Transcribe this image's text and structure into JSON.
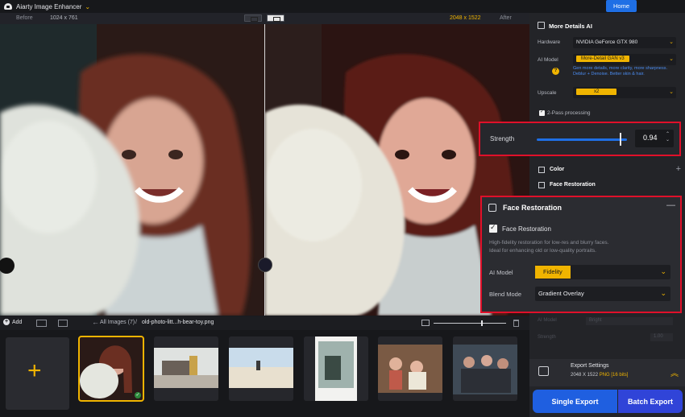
{
  "app": {
    "title": "Aiarty Image Enhancer",
    "home_label": "Home"
  },
  "view": {
    "before_label": "Before",
    "before_dims": "1024 x 761",
    "after_dims": "2048 x 1522",
    "after_label": "After"
  },
  "filmstrip": {
    "add_label": "Add",
    "breadcrumb_all": "All Images (7)",
    "breadcrumb_sep": "/",
    "breadcrumb_file": "old-photo-litt...h-bear-toy.png",
    "add_tile_plus": "+",
    "selected_check": "✓"
  },
  "panel": {
    "section_title": "More Details AI",
    "hardware_label": "Hardware",
    "hardware_value": "NVIDIA GeForce GTX 980",
    "ai_model_label": "AI Model",
    "ai_model_value": "More-Detail GAN  v3",
    "help_icon": "?",
    "ai_model_desc": "Gen more details, more clarity, more sharpness. Deblur + Denoise. Better skin & hair.",
    "upscale_label": "Upscale",
    "upscale_value": "x2",
    "two_pass_label": "2-Pass processing",
    "strength_label": "Strength",
    "strength_value": "0.94",
    "color_label": "Color",
    "face_restoration_label": "Face Restoration",
    "ghost_ai_model": "AI Model",
    "ghost_bright": "Bright",
    "ghost_strength": "Strength",
    "ghost_strength_value": "1.00"
  },
  "face_restoration": {
    "title": "Face Restoration",
    "checkbox_label": "Face Restoration",
    "desc_line1": "High-fidelity restoration for low-res and blurry faces.",
    "desc_line2": "Ideal for enhancing old or low-quality portraits.",
    "ai_model_label": "AI Model",
    "ai_model_value": "Fidelity",
    "blend_mode_label": "Blend Mode",
    "blend_mode_value": "Gradient Overlay"
  },
  "export": {
    "title": "Export Settings",
    "dims": "2048 X 1522",
    "format": "PNG",
    "bits": "[16 bits]",
    "single_label": "Single Export",
    "batch_label": "Batch Export"
  },
  "controls": {
    "strength_level": 0.94,
    "zoom_level": 0.66
  }
}
